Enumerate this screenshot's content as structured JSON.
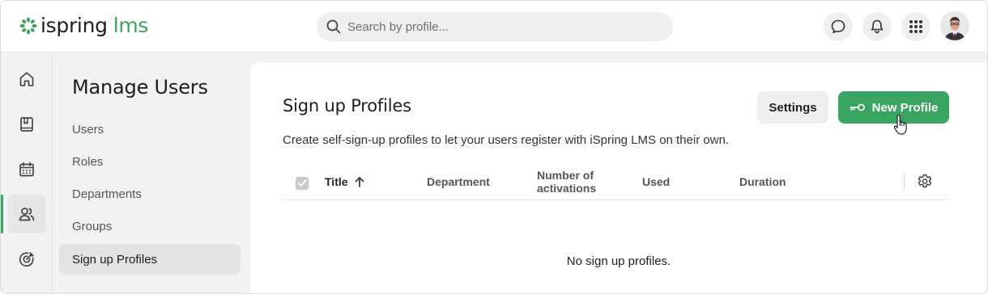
{
  "app": {
    "brand_word": "ispring",
    "brand_suffix": "lms",
    "brand_color": "#3aa463"
  },
  "header": {
    "search": {
      "placeholder": "Search by profile...",
      "value": ""
    },
    "icons": [
      "chat-icon",
      "bell-icon",
      "apps-grid-icon",
      "avatar"
    ]
  },
  "rail": {
    "items": [
      {
        "icon": "home-icon",
        "active": false
      },
      {
        "icon": "book-icon",
        "active": false
      },
      {
        "icon": "calendar-icon",
        "active": false
      },
      {
        "icon": "users-icon",
        "active": true
      },
      {
        "icon": "target-icon",
        "active": false
      }
    ]
  },
  "sidebar": {
    "title": "Manage Users",
    "items": [
      {
        "label": "Users",
        "active": false
      },
      {
        "label": "Roles",
        "active": false
      },
      {
        "label": "Departments",
        "active": false
      },
      {
        "label": "Groups",
        "active": false
      },
      {
        "label": "Sign up Profiles",
        "active": true
      }
    ]
  },
  "main": {
    "title": "Sign up Profiles",
    "description": "Create self-sign-up profiles to let your users register with iSpring LMS on their own.",
    "settings_label": "Settings",
    "new_profile_label": "New Profile",
    "table": {
      "columns": {
        "title": "Title",
        "department": "Department",
        "activations_line1": "Number of",
        "activations_line2": "activations",
        "used": "Used",
        "duration": "Duration"
      },
      "sort_column": "Title",
      "sort_direction": "ascending",
      "rows": [],
      "empty_text": "No sign up profiles."
    }
  }
}
